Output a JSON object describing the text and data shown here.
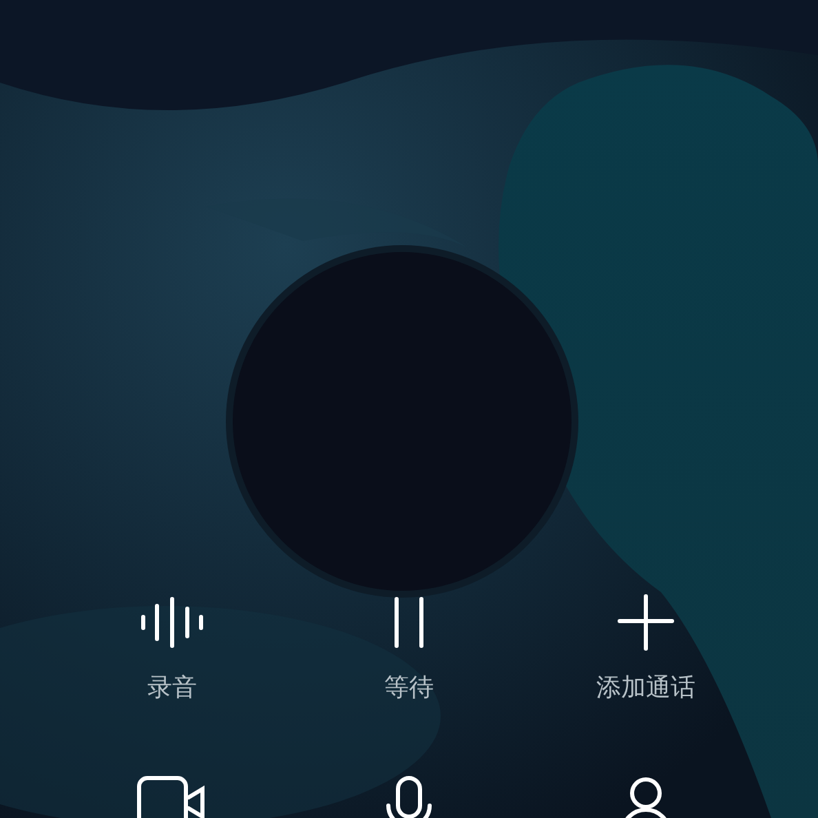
{
  "controls": [
    {
      "kind": "record",
      "label": "录音"
    },
    {
      "kind": "hold",
      "label": "等待"
    },
    {
      "kind": "add_call",
      "label": "添加通话"
    }
  ],
  "bottom_controls": [
    {
      "kind": "video"
    },
    {
      "kind": "mute"
    },
    {
      "kind": "contacts"
    }
  ]
}
